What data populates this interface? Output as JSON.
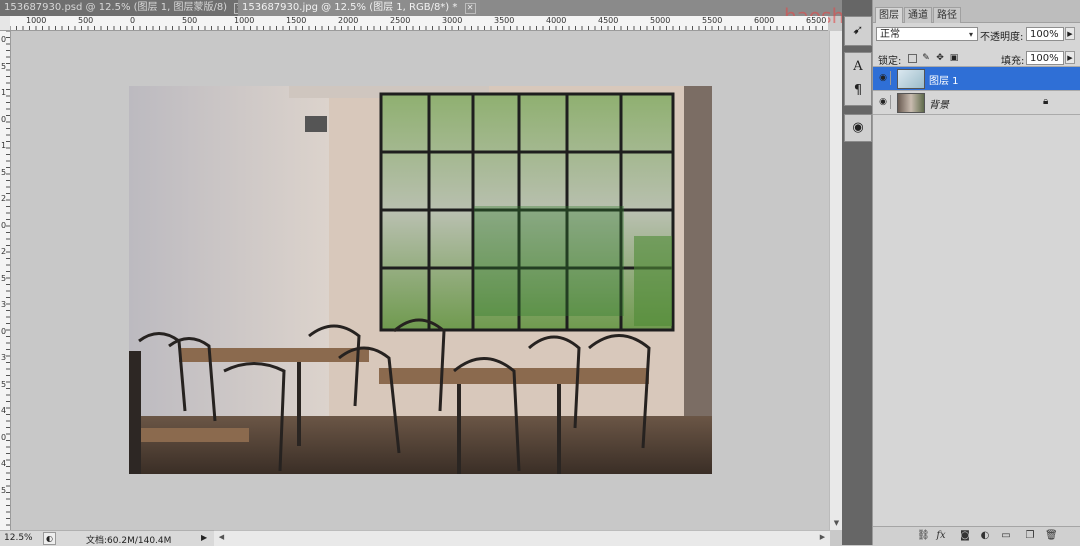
{
  "tabs": [
    {
      "label": "153687930.psd @ 12.5% (图层 1, 图层蒙版/8)",
      "close": "✕"
    },
    {
      "label": "153687930.jpg @ 12.5% (图层 1, RGB/8*) *",
      "close": "✕"
    }
  ],
  "ruler_top_ticks": [
    "1000",
    "500",
    "0",
    "500",
    "1000",
    "1500",
    "2000",
    "2500",
    "3000",
    "3500",
    "4000",
    "4500",
    "5000",
    "5500",
    "6000",
    "6500"
  ],
  "ruler_left_ticks": [
    "0",
    "5",
    "1",
    "0",
    "1",
    "5",
    "2",
    "0",
    "2",
    "5",
    "3",
    "0",
    "3",
    "5",
    "4",
    "0",
    "4",
    "5"
  ],
  "status": {
    "zoom": "12.5%",
    "doc_info": "文档:60.2M/140.4M"
  },
  "watermark": "haoshejianshеji.com",
  "panel": {
    "tabs": [
      "图层",
      "通道",
      "路径"
    ],
    "blend_mode": "正常",
    "opacity_label": "不透明度:",
    "opacity_value": "100%",
    "lock_label": "锁定:",
    "fill_label": "填充:",
    "fill_value": "100%",
    "layers": [
      {
        "name": "图层 1",
        "selected": true
      },
      {
        "name": "背景",
        "selected": false
      }
    ]
  },
  "icons": {
    "eye": "eye-icon",
    "lock": "lock-icon",
    "link": "link-icon",
    "fx": "fx-icon",
    "mask": "mask-icon",
    "adjust": "adjustment-icon",
    "group": "folder-icon",
    "new": "new-layer-icon",
    "trash": "trash-icon"
  },
  "colors": {
    "selection": "#2f6fd6",
    "watermark": "#e24a4a"
  }
}
